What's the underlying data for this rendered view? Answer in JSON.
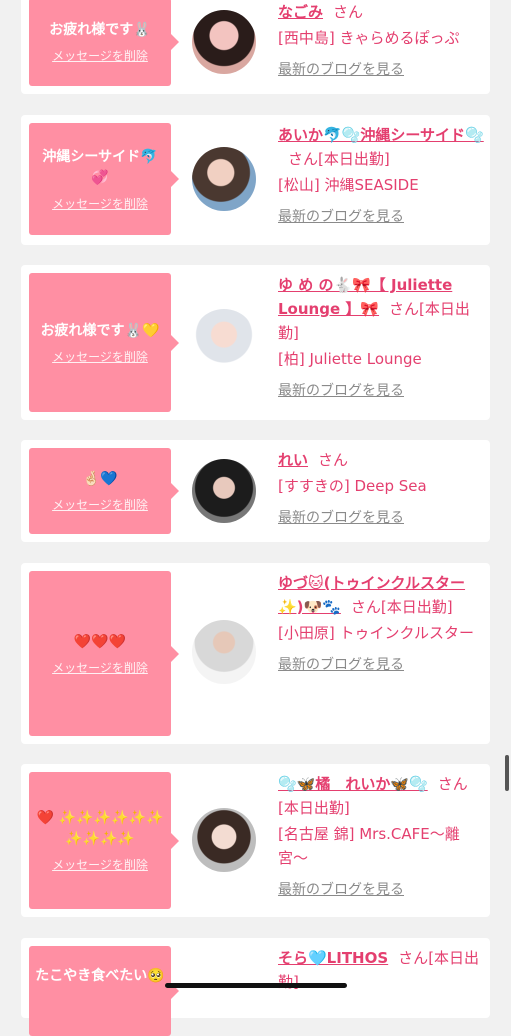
{
  "delete_label": "メッセージを削除",
  "blog_label": "最新のブログを見る",
  "san_label": "さん",
  "cards": [
    {
      "message": "お疲れ様です🐰",
      "name": "なごみ",
      "suffix": "",
      "shop": "[西中島] きゃらめるぽっぷ"
    },
    {
      "message": "沖縄シーサイド🐬💞",
      "name": "あいか🐬🫧沖縄シーサイド🫧",
      "suffix": "[本日出勤]",
      "shop": "[松山] 沖縄SEASIDE"
    },
    {
      "message": "お疲れ様です🐰💛",
      "name": "ゆ め の🐇🎀【 Juliette Lounge 】🎀",
      "suffix": "[本日出勤]",
      "shop": "[柏] Juliette Lounge"
    },
    {
      "message": "🤞🏻💙",
      "name": "れい",
      "suffix": "",
      "shop": "[すすきの] Deep Sea"
    },
    {
      "message": "❤️❤️❤️",
      "name": "ゆづ🐱(トゥインクルスター✨)🐶🐾",
      "suffix": "[本日出勤]",
      "shop": "[小田原] トゥインクルスター"
    },
    {
      "message": "❤️ ✨✨✨✨✨✨✨✨✨✨",
      "name": "🫧🦋橘　れいか🦋🫧",
      "suffix": "[本日出勤]",
      "shop": "[名古屋 錦] Mrs.CAFE〜離宮〜"
    },
    {
      "message": "たこやき食べたい🥺",
      "name": "そら🩵LITHOS",
      "suffix": "[本日出勤]",
      "shop": ""
    }
  ]
}
